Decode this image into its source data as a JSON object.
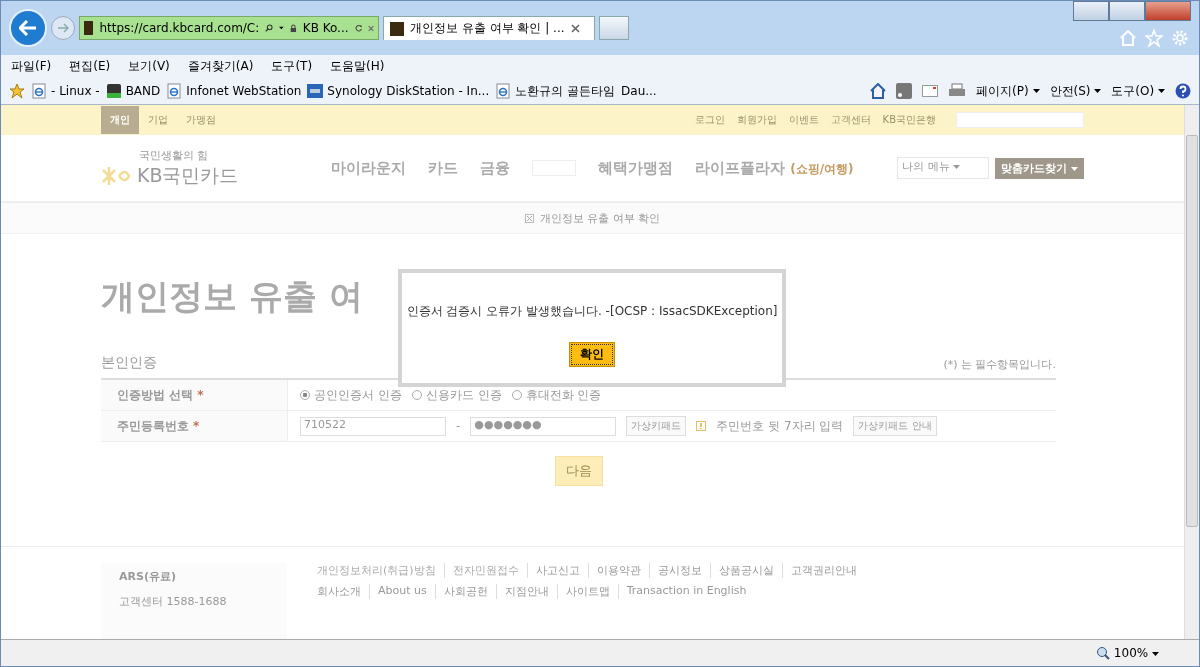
{
  "browser": {
    "address": "https://card.kbcard.com/C:",
    "site_label": "KB Ko...",
    "tabs": [
      {
        "title": "개인정보 유출 여부 확인 | ...",
        "selected": true
      }
    ],
    "menu": [
      "파일(F)",
      "편집(E)",
      "보기(V)",
      "즐겨찾기(A)",
      "도구(T)",
      "도움말(H)"
    ],
    "favorites": [
      {
        "label": "- Linux -",
        "kind": "ie"
      },
      {
        "label": "BAND",
        "kind": "band"
      },
      {
        "label": "Infonet WebStation",
        "kind": "ie"
      },
      {
        "label": "Synology DiskStation - In...",
        "kind": "dsm"
      },
      {
        "label": "노환규의 골든타임",
        "kind": "ie"
      },
      {
        "label": "Dau...",
        "kind": "plain"
      }
    ],
    "commands": [
      "페이지(P)",
      "안전(S)",
      "도구(O)"
    ],
    "zoom": "100%"
  },
  "page": {
    "top_tabs": [
      {
        "label": "개인",
        "selected": true
      },
      {
        "label": "기업",
        "selected": false
      },
      {
        "label": "가맹점",
        "selected": false
      }
    ],
    "util_links": [
      "로그인",
      "회원가입",
      "이벤트",
      "고객센터",
      "KB국민은행"
    ],
    "logo": {
      "tagline": "국민생활의 힘",
      "name": "KB국민카드"
    },
    "nav": [
      {
        "label": "마이라운지"
      },
      {
        "label": "카드"
      },
      {
        "label": "금융"
      },
      {
        "label": "혜택가맹점"
      },
      {
        "label": "라이프플라자",
        "sub": "(쇼핑/여행)"
      }
    ],
    "my_menu": "나의 메뉴",
    "find_card": "맞춤카드찾기",
    "breadcrumb": "개인정보 유출 여부 확인",
    "heading": "개인정보 유출 여",
    "section": "본인인증",
    "required_note": "(*) 는 필수항목입니다.",
    "method_label": "인증방법 선택",
    "methods": [
      {
        "label": "공인인증서 인증",
        "selected": true
      },
      {
        "label": "신용카드 인증",
        "selected": false
      },
      {
        "label": "휴대전화 인증",
        "selected": false
      }
    ],
    "required_mark": "*",
    "rrn_label": "주민등록번호",
    "rrn_front": "710522",
    "rrn_separator": "-",
    "rrn_back": "●●●●●●●",
    "keypad": "가상키패드",
    "rrn_hint": "주민번호 뒷 7자리 입력",
    "keypad_guide": "가상키패드 안내",
    "next": "다음",
    "footer": {
      "ars": "ARS(유료)",
      "center": "고객센터 1588-1688",
      "links_1": [
        "개인정보처리(취급)방침",
        "전자민원접수",
        "사고신고",
        "이용약관",
        "공시정보",
        "상품공시실",
        "고객권리안내"
      ],
      "links_2": [
        "회사소개",
        "About us",
        "사회공헌",
        "지점안내",
        "사이트맵",
        "Transaction in English"
      ]
    }
  },
  "dialog": {
    "message": "인증서 검증시 오류가 발생했습니다. -[OCSP : IssacSDKException]",
    "button": "확인"
  }
}
